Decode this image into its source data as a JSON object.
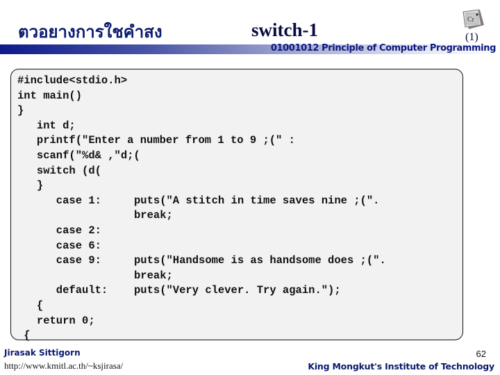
{
  "header": {
    "title_thai": "ตวอยางการใชคำสง",
    "title": "switch-1",
    "logo_icon": "c-program-chip-icon",
    "slide_part": "(1)",
    "course": "01001012 Principle of Computer Programming",
    "bar_color_start": "#0d1a8a",
    "bar_color_end": "#ffffff"
  },
  "code": {
    "lines": [
      {
        "text": "#include<stdio.h>",
        "right": ""
      },
      {
        "text": "int main()",
        "right": ""
      },
      {
        "text": "}",
        "right": ""
      },
      {
        "text": "   int d;",
        "right": ""
      },
      {
        "text": "   printf(\"Enter a number from 1 to 9 ;(\" :",
        "right": ""
      },
      {
        "text": "   scanf(\"%d& ,\"d;(",
        "right": ""
      },
      {
        "text": "   switch (d(",
        "right": ""
      },
      {
        "text": "   }",
        "right": ""
      },
      {
        "text": "      case 1:",
        "right": "puts(\"A stitch in time saves nine ;(\"."
      },
      {
        "text": "",
        "right": "break;"
      },
      {
        "text": "      case 2:",
        "right": ""
      },
      {
        "text": "      case 6:",
        "right": ""
      },
      {
        "text": "      case 9:",
        "right": "puts(\"Handsome is as handsome does ;(\"."
      },
      {
        "text": "",
        "right": "break;"
      },
      {
        "text": "      default:",
        "right": "puts(\"Very clever. Try again.\");"
      },
      {
        "text": "   {",
        "right": ""
      },
      {
        "text": "   return 0;",
        "right": ""
      },
      {
        "text": " {",
        "right": ""
      }
    ]
  },
  "footer": {
    "author": "Jirasak Sittigorn",
    "url": "http://www.kmitl.ac.th/~ksjirasa/",
    "page_number": "62",
    "institute": "King Mongkut's Institute of Technology"
  }
}
